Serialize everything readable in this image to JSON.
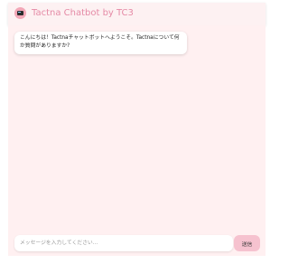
{
  "header": {
    "title": "Tactna Chatbot by TC3",
    "icon": "computer-icon"
  },
  "chat": {
    "messages": [
      {
        "role": "bot",
        "text": "こんにちは！Tactnaチャットボットへようこそ。Tactnaについて何か質問がありますか?"
      }
    ]
  },
  "composer": {
    "placeholder": "メッセージを入力してください...",
    "value": "",
    "send_label": "送信"
  },
  "colors": {
    "header_bg": "#fdf1f2",
    "chat_bg": "#fff0f1",
    "title": "#e58aa6",
    "send_button": "#f6c2cf"
  }
}
